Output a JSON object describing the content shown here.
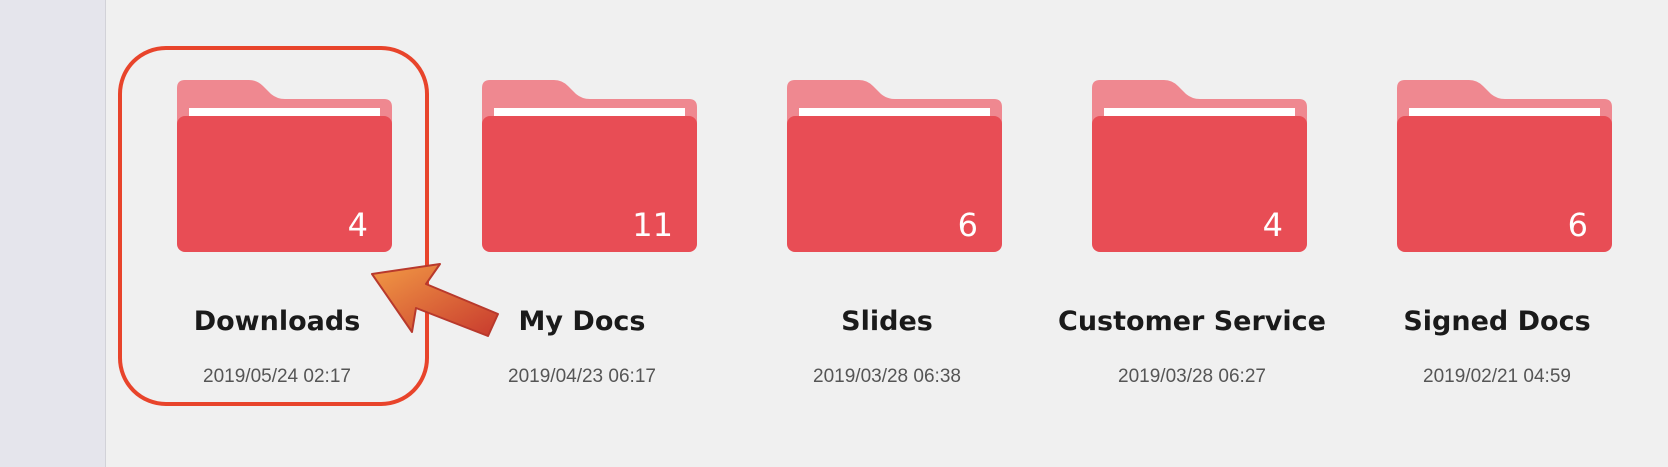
{
  "folders": [
    {
      "name": "Downloads",
      "date": "2019/05/24 02:17",
      "count": "4",
      "icon": "folder-icon"
    },
    {
      "name": "My Docs",
      "date": "2019/04/23 06:17",
      "count": "11",
      "icon": "folder-icon"
    },
    {
      "name": "Slides",
      "date": "2019/03/28 06:38",
      "count": "6",
      "icon": "folder-icon"
    },
    {
      "name": "Customer Service",
      "date": "2019/03/28 06:27",
      "count": "4",
      "icon": "folder-icon"
    },
    {
      "name": "Signed Docs",
      "date": "2019/02/21 04:59",
      "count": "6",
      "icon": "folder-icon"
    }
  ],
  "highlight": {
    "target": "Downloads",
    "color": "#e8442b"
  },
  "colors": {
    "folder_front": "#e84d55",
    "folder_back": "#ef8890",
    "background": "#f0f0f0",
    "sidebar": "#e5e5ec"
  }
}
